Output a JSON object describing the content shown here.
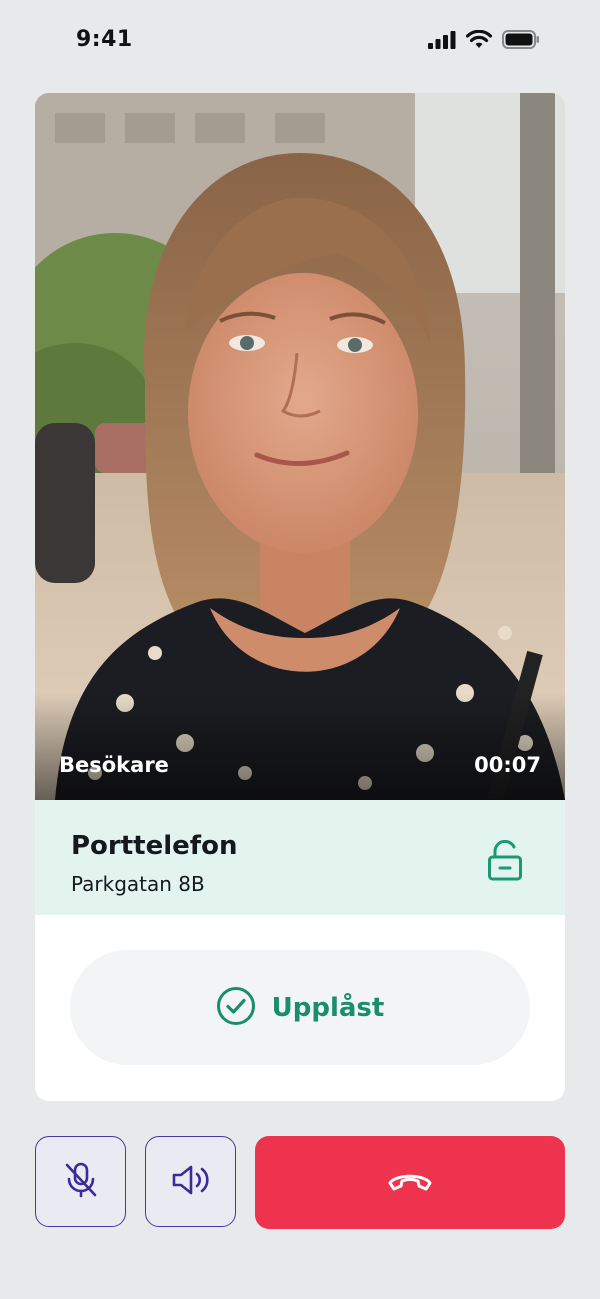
{
  "status_bar": {
    "time": "9:41",
    "icons": [
      "signal-icon",
      "wifi-icon",
      "battery-icon"
    ]
  },
  "call": {
    "video": {
      "role_label": "Besökare",
      "timer": "00:07"
    },
    "info": {
      "title": "Porttelefon",
      "address": "Parkgatan 8B",
      "lock_icon": "unlock-icon"
    },
    "door_status": {
      "label": "Upplåst",
      "icon": "check-circle-icon"
    }
  },
  "controls": {
    "buttons": [
      {
        "name": "mute",
        "icon": "mic-off-icon"
      },
      {
        "name": "speaker",
        "icon": "speaker-icon"
      },
      {
        "name": "end-call",
        "icon": "phone-hangup-icon"
      }
    ]
  },
  "colors": {
    "background": "#e8e9ea",
    "accent_green": "#1a8d69",
    "info_panel": "#e3f4ef",
    "end_call_red": "#ee334e",
    "control_border": "#4b36a8"
  }
}
